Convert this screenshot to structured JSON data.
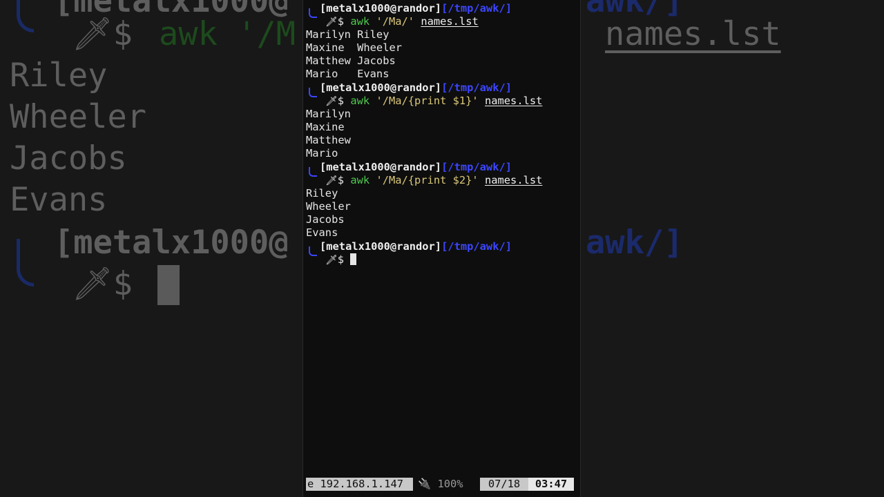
{
  "prompt": {
    "user_host": "[metalx1000@randor]",
    "path": "[/tmp/awk/]",
    "symbol": "$",
    "icon": "dagger-icon"
  },
  "commands": [
    {
      "cmd": "awk",
      "arg": "'/Ma/'",
      "file": "names.lst",
      "output": [
        "Marilyn Riley",
        "Maxine  Wheeler",
        "Matthew Jacobs",
        "Mario   Evans"
      ]
    },
    {
      "cmd": "awk",
      "arg": "'/Ma/{print $1}'",
      "file": "names.lst",
      "output": [
        "Marilyn",
        "Maxine",
        "Matthew",
        "Mario"
      ]
    },
    {
      "cmd": "awk",
      "arg": "'/Ma/{print $2}'",
      "file": "names.lst",
      "output": [
        "Riley",
        "Wheeler",
        "Jacobs",
        "Evans"
      ]
    }
  ],
  "status_bar": {
    "ip": "e 192.168.1.147",
    "battery": "100%",
    "date": "07/18",
    "time": "03:47"
  },
  "background": {
    "words": [
      "Riley",
      "Wheeler",
      "Jacobs",
      "Evans"
    ],
    "top_user": "[metalx1000@",
    "top_cmd": "awk '/M",
    "top_file": "names.lst",
    "top_path": "awk/]",
    "bottom_user": "[metalx1000@",
    "bottom_path": "awk/]"
  },
  "colors": {
    "path_blue": "#3c46ff",
    "cmd_green": "#4ec94e",
    "string_yellow": "#d9c77a"
  }
}
